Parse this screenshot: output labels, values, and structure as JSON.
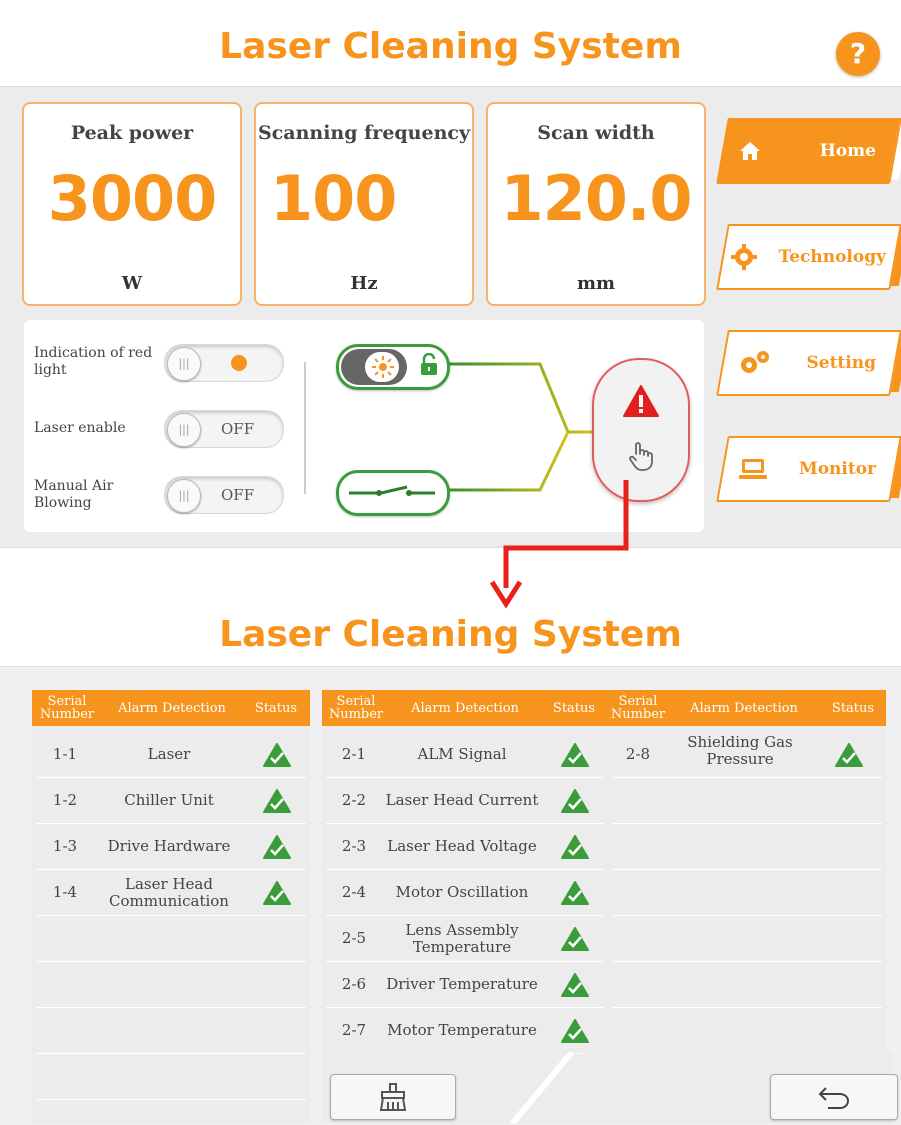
{
  "top_screen": {
    "title": "Laser Cleaning System",
    "help_label": "?",
    "metrics": [
      {
        "label": "Peak power",
        "value": "3000",
        "unit": "W"
      },
      {
        "label": "Scanning frequency",
        "value": "100",
        "unit": "Hz"
      },
      {
        "label": "Scan width",
        "value": "120.0",
        "unit": "mm"
      }
    ],
    "nav": [
      {
        "label": "Home",
        "icon": "home-icon",
        "active": true
      },
      {
        "label": "Technology",
        "icon": "gear-icon",
        "active": false
      },
      {
        "label": "Setting",
        "icon": "settings-gears-icon",
        "active": false
      },
      {
        "label": "Monitor",
        "icon": "monitor-icon",
        "active": false
      }
    ],
    "controls": [
      {
        "label": "Indication of red light",
        "state": "ON"
      },
      {
        "label": "Laser enable",
        "state": "OFF"
      },
      {
        "label": "Manual Air Blowing",
        "state": "OFF"
      }
    ],
    "accent_color": "#f7941d",
    "ok_color": "#3a9c3a",
    "alarm_color": "#e02020"
  },
  "bottom_screen": {
    "title": "Laser Cleaning System",
    "columns": {
      "serial": "Serial Number",
      "alarm": "Alarm Detection",
      "status": "Status"
    },
    "table1": [
      {
        "serial": "1-1",
        "alarm": "Laser",
        "status": "ok"
      },
      {
        "serial": "1-2",
        "alarm": "Chiller Unit",
        "status": "ok"
      },
      {
        "serial": "1-3",
        "alarm": "Drive Hardware",
        "status": "ok"
      },
      {
        "serial": "1-4",
        "alarm": "Laser Head Communication",
        "status": "ok"
      }
    ],
    "table2": [
      {
        "serial": "2-1",
        "alarm": "ALM Signal",
        "status": "ok"
      },
      {
        "serial": "2-2",
        "alarm": "Laser Head Current",
        "status": "ok"
      },
      {
        "serial": "2-3",
        "alarm": "Laser Head Voltage",
        "status": "ok"
      },
      {
        "serial": "2-4",
        "alarm": "Motor Oscillation",
        "status": "ok"
      },
      {
        "serial": "2-5",
        "alarm": "Lens Assembly Temperature",
        "status": "ok"
      },
      {
        "serial": "2-6",
        "alarm": "Driver Temperature",
        "status": "ok"
      },
      {
        "serial": "2-7",
        "alarm": "Motor Temperature",
        "status": "ok"
      }
    ],
    "table3": [
      {
        "serial": "2-8",
        "alarm": "Shielding Gas Pressure",
        "status": "ok"
      }
    ]
  }
}
